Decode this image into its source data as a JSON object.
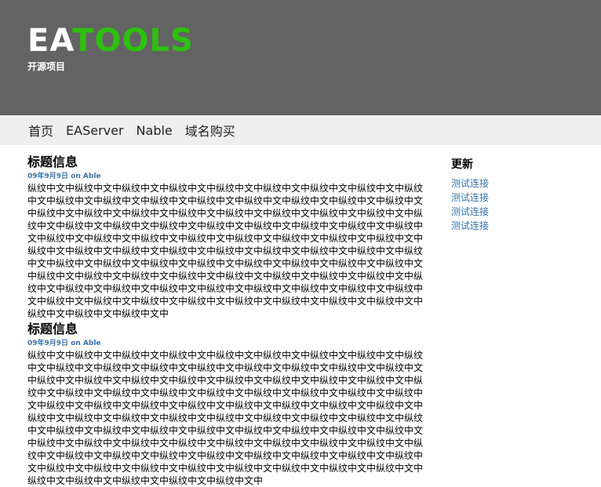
{
  "header": {
    "logo_part1": "EA",
    "logo_part2": "TOOLS",
    "tagline": "开源项目"
  },
  "nav": {
    "items": [
      "首页",
      "EAServer",
      "Nable",
      "域名购买"
    ]
  },
  "posts": [
    {
      "title": "标题信息",
      "meta": "09年9月9日 on Able",
      "body": "纵纹中文中纵纹中文中纵纹中文中纵纹中文中纵纹中文中纵纹中文中纵纹中文中纵纹中文中纵纹中文中纵纹中文中纵纹中文中纵纹中文中纵纹中文中纵纹中文中纵纹中文中纵纹中文中纵纹中文中纵纹中文中纵纹中文中纵纹中文中纵纹中文中纵纹中文中纵纹中文中纵纹中文中纵纹中文中纵纹中文中纵纹中文中纵纹中文中纵纹中文中纵纹中文中纵纹中文中纵纹中文中纵纹中文中纵纹中文中纵纹中文中纵纹中文中纵纹中文中纵纹中文中纵纹中文中纵纹中文中纵纹中文中纵纹中文中纵纹中文中纵纹中文中纵纹中文中纵纹中文中纵纹中文中纵纹中文中纵纹中文中纵纹中文中纵纹中文中纵纹中文中纵纹中文中纵纹中文中纵纹中文中纵纹中文中纵纹中文中纵纹中文中纵纹中文中纵纹中文中纵纹中文中纵纹中文中纵纹中文中纵纹中文中纵纹中文中纵纹中文中纵纹中文中纵纹中文中纵纹中文中纵纹中文中纵纹中文中纵纹中文中纵纹中文中纵纹中文中纵纹中文中纵纹中文中纵纹中文中纵纹中文中纵纹中文中纵纹中文中纵纹中文中纵纹中文中纵纹中文中纵纹中文中纵纹中文中纵纹中文中纵纹中文中"
    },
    {
      "title": "标题信息",
      "meta": "09年9月9日 on Able",
      "body": "纵纹中文中纵纹中文中纵纹中文中纵纹中文中纵纹中文中纵纹中文中纵纹中文中纵纹中文中纵纹中文中纵纹中文中纵纹中文中纵纹中文中纵纹中文中纵纹中文中纵纹中文中纵纹中文中纵纹中文中纵纹中文中纵纹中文中纵纹中文中纵纹中文中纵纹中文中纵纹中文中纵纹中文中纵纹中文中纵纹中文中纵纹中文中纵纹中文中纵纹中文中纵纹中文中纵纹中文中纵纹中文中纵纹中文中纵纹中文中纵纹中文中纵纹中文中纵纹中文中纵纹中文中纵纹中文中纵纹中文中纵纹中文中纵纹中文中纵纹中文中纵纹中文中纵纹中文中纵纹中文中纵纹中文中纵纹中文中纵纹中文中纵纹中文中纵纹中文中纵纹中文中纵纹中文中纵纹中文中纵纹中文中纵纹中文中纵纹中文中纵纹中文中纵纹中文中纵纹中文中纵纹中文中纵纹中文中纵纹中文中纵纹中文中纵纹中文中纵纹中文中纵纹中文中纵纹中文中纵纹中文中纵纹中文中纵纹中文中纵纹中文中纵纹中文中纵纹中文中纵纹中文中纵纹中文中纵纹中文中纵纹中文中纵纹中文中纵纹中文中纵纹中文中纵纹中文中纵纹中文中纵纹中文中纵纹中文中纵纹中文中纵纹中文中纵纹中文中纵纹中文中"
    }
  ],
  "sidebar": {
    "title": "更新",
    "links": [
      "测试连接",
      "测试连接",
      "测试连接",
      "测试连接"
    ]
  },
  "colors": {
    "header_bg": "#636363",
    "logo_accent": "#2ec00f",
    "nav_bg": "#efefef",
    "link": "#3a73a8"
  }
}
